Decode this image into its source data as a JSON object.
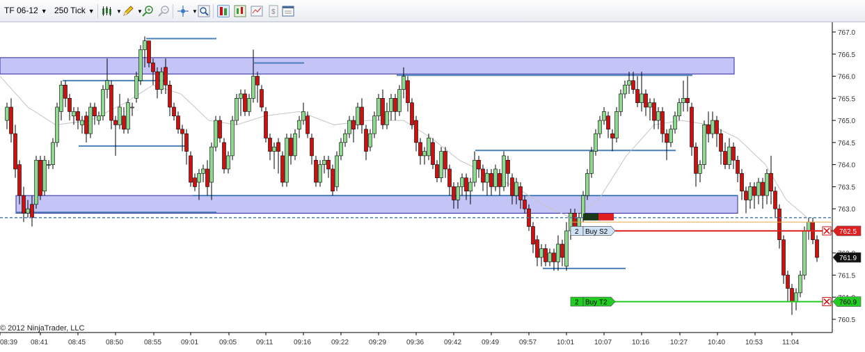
{
  "toolbar": {
    "instrument": "TF 06-12",
    "interval": "250 Tick",
    "buttons": [
      "bar-type-icon",
      "pencil-draw-icon",
      "zoom-in-icon",
      "zoom-out-icon",
      "crosshair-icon",
      "magnifier-icon",
      "chart-trader-icon",
      "indicators-icon",
      "strategies-icon",
      "data-box-icon",
      "properties-icon"
    ]
  },
  "chart": {
    "copyright": "© 2012 NinjaTrader, LLC",
    "price_axis": [
      "767.0",
      "766.5",
      "766.0",
      "765.5",
      "765.0",
      "764.5",
      "764.0",
      "763.5",
      "763.0",
      "762.5",
      "762.0",
      "761.5",
      "761.0",
      "760.5"
    ],
    "price_range": [
      760.3,
      767.1
    ],
    "time_axis": [
      "08:39",
      "08:41",
      "08:45",
      "08:50",
      "08:55",
      "09:01",
      "09:05",
      "09:11",
      "09:16",
      "09:22",
      "09:29",
      "09:36",
      "09:42",
      "09:49",
      "09:57",
      "10:01",
      "10:07",
      "10:16",
      "10:27",
      "10:40",
      "10:53",
      "11:04"
    ],
    "last_price_label": "761.9",
    "stop_price_label": "762.5",
    "target_price_label": "760.9",
    "last_price": 761.9,
    "stop_price": 762.5,
    "target_price": 760.9,
    "entry_price": 762.8,
    "orders": [
      {
        "qty": "2",
        "label": "Buy S2",
        "color": "#e02020",
        "price": 762.5
      },
      {
        "qty": "2",
        "label": "Buy T2",
        "color": "#22cc22",
        "price": 760.9
      }
    ],
    "zones": [
      {
        "name": "supply-zone",
        "low": 766.05,
        "high": 766.42
      },
      {
        "name": "demand-zone",
        "low": 762.9,
        "high": 763.3
      }
    ],
    "colors": {
      "up": "#8fd88f",
      "down": "#cc1111",
      "zone": "#c4c4f7",
      "level": "#4a7fb8",
      "stop": "#e02020",
      "target": "#22cc22"
    }
  }
}
